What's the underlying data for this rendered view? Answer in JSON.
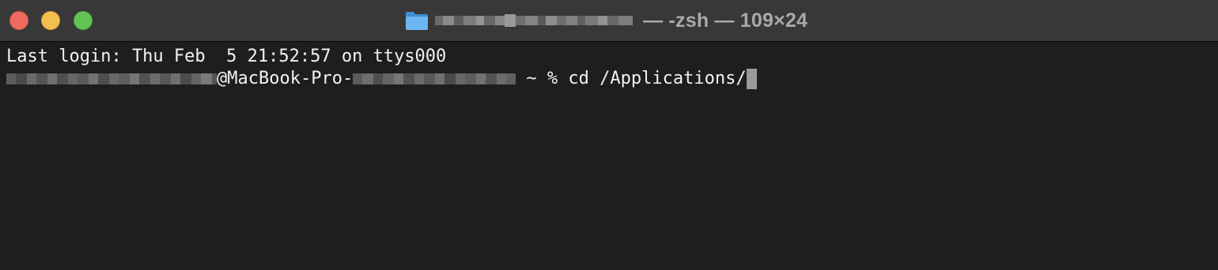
{
  "window": {
    "title_suffix": " — -zsh — 109×24",
    "title_folder_icon": "folder-icon"
  },
  "terminal": {
    "last_login": "Last login: Thu Feb  5 21:52:57 on ttys000",
    "host_fragment": "@MacBook-Pro-",
    "prompt": " ~ % ",
    "command": "cd /Applications/"
  },
  "colors": {
    "background": "#1e1e1e",
    "titlebar": "#383838",
    "text": "#f2f2f2",
    "close": "#ed6a5e",
    "minimize": "#f5bf4f",
    "zoom": "#61c554",
    "cursor": "#9a9a9a"
  }
}
